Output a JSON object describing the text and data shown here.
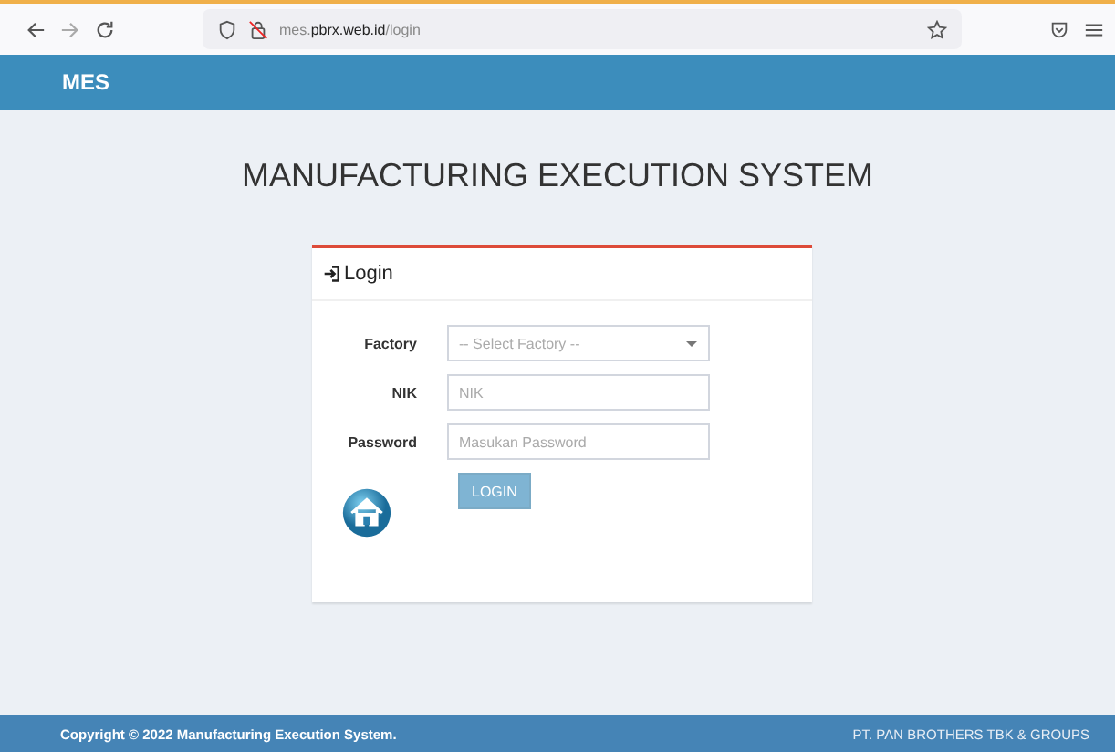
{
  "browser": {
    "url_host": "mes.",
    "url_domain": "pbrx.web.id",
    "url_path": "/login"
  },
  "navbar": {
    "brand": "MES"
  },
  "page_title": "MANUFACTURING EXECUTION SYSTEM",
  "login_card": {
    "title": "Login",
    "fields": [
      {
        "kind": "select",
        "label": "Factory",
        "placeholder": "-- Select Factory --"
      },
      {
        "kind": "text",
        "label": "NIK",
        "placeholder": "NIK"
      },
      {
        "kind": "password",
        "label": "Password",
        "placeholder": "Masukan Password"
      }
    ],
    "button": {
      "label": "LOGIN",
      "disabled": true
    }
  },
  "footer": {
    "left": "Copyright © 2022 Manufacturing Execution System.",
    "right": "PT. PAN BROTHERS TBK & GROUPS"
  }
}
